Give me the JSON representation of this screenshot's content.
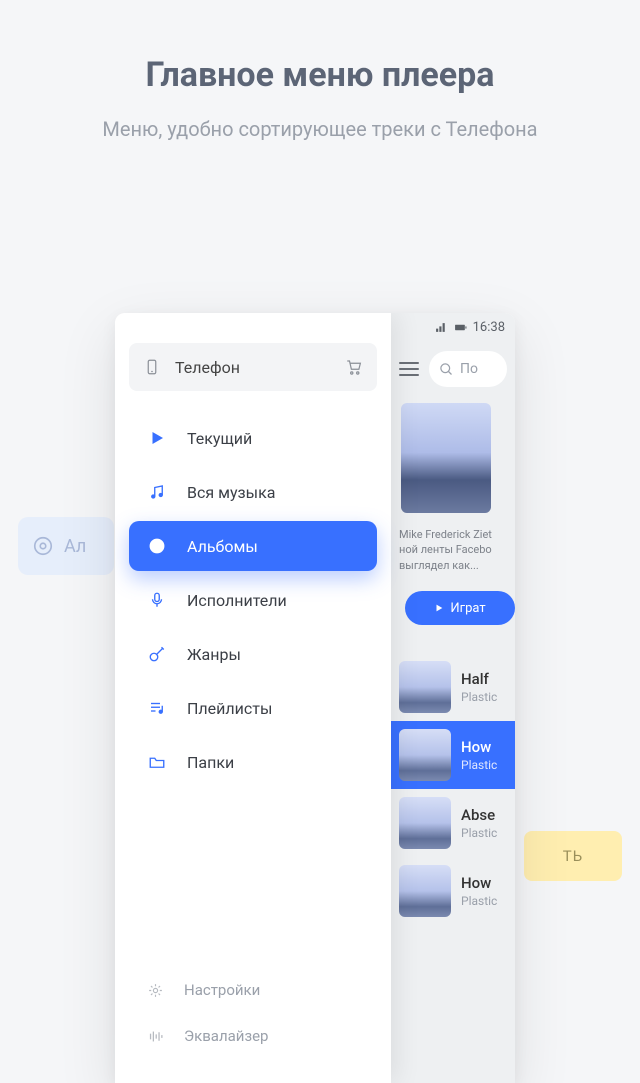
{
  "page": {
    "title": "Главное меню плеера",
    "subtitle": "Меню, удобно сортирующее треки с Телефона"
  },
  "decor": {
    "left_pill_text": "Ал",
    "right_chip_text": "ТЬ"
  },
  "statusbar": {
    "time": "16:38"
  },
  "bg_header": {
    "search_prefix": "По"
  },
  "bg_card": {
    "caption_line1": "Mike Frederick Ziet",
    "caption_line2": "ной ленты Facebo",
    "caption_line3": "выглядел как...",
    "play_label": "Играт"
  },
  "tracks": [
    {
      "title": "Half",
      "artist": "Plastic"
    },
    {
      "title": "How",
      "artist": "Plastic"
    },
    {
      "title": "Abse",
      "artist": "Plastic"
    },
    {
      "title": "How",
      "artist": "Plastic"
    }
  ],
  "drawer": {
    "head_label": "Телефон",
    "items": [
      {
        "label": "Текущий"
      },
      {
        "label": "Вся музыка"
      },
      {
        "label": "Альбомы"
      },
      {
        "label": "Исполнители"
      },
      {
        "label": "Жанры"
      },
      {
        "label": "Плейлисты"
      },
      {
        "label": "Папки"
      }
    ],
    "bottom": [
      {
        "label": "Настройки"
      },
      {
        "label": "Эквалайзер"
      }
    ]
  }
}
